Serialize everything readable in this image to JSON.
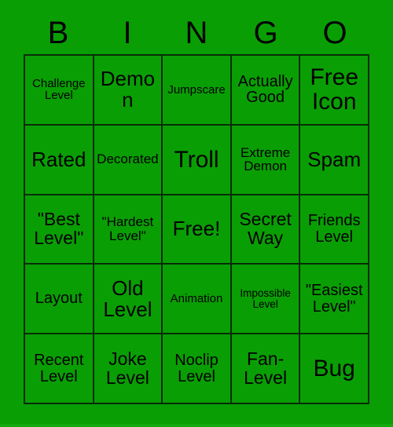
{
  "card": {
    "title": "BINGO",
    "header_letters": [
      "B",
      "I",
      "N",
      "G",
      "O"
    ],
    "background_color": "#0a9e05",
    "border_color": "#062d06",
    "text_color": "#000000",
    "rows": 5,
    "columns": 5,
    "cells": [
      [
        {
          "text": "Challenge Level",
          "size": "sm"
        },
        {
          "text": "Demon",
          "size": "2xl"
        },
        {
          "text": "Jumpscare",
          "size": "sm"
        },
        {
          "text": "Actually Good",
          "size": "lg"
        },
        {
          "text": "Free Icon",
          "size": "3xl"
        }
      ],
      [
        {
          "text": "Rated",
          "size": "2xl"
        },
        {
          "text": "Decorated",
          "size": "md"
        },
        {
          "text": "Troll",
          "size": "3xl"
        },
        {
          "text": "Extreme Demon",
          "size": "md"
        },
        {
          "text": "Spam",
          "size": "2xl"
        }
      ],
      [
        {
          "text": "\"Best Level\"",
          "size": "xl"
        },
        {
          "text": "\"Hardest Level\"",
          "size": "md"
        },
        {
          "text": "Free!",
          "size": "2xl"
        },
        {
          "text": "Secret Way",
          "size": "xl"
        },
        {
          "text": "Friends Level",
          "size": "lg"
        }
      ],
      [
        {
          "text": "Layout",
          "size": "lg"
        },
        {
          "text": "Old Level",
          "size": "2xl"
        },
        {
          "text": "Animation",
          "size": "sm"
        },
        {
          "text": "Impossible Level",
          "size": "xs"
        },
        {
          "text": "\"Easiest Level\"",
          "size": "lg"
        }
      ],
      [
        {
          "text": "Recent Level",
          "size": "lg"
        },
        {
          "text": "Joke Level",
          "size": "xl"
        },
        {
          "text": "Noclip Level",
          "size": "lg"
        },
        {
          "text": "Fan-Level",
          "size": "xl"
        },
        {
          "text": "Bug",
          "size": "3xl"
        }
      ]
    ]
  }
}
